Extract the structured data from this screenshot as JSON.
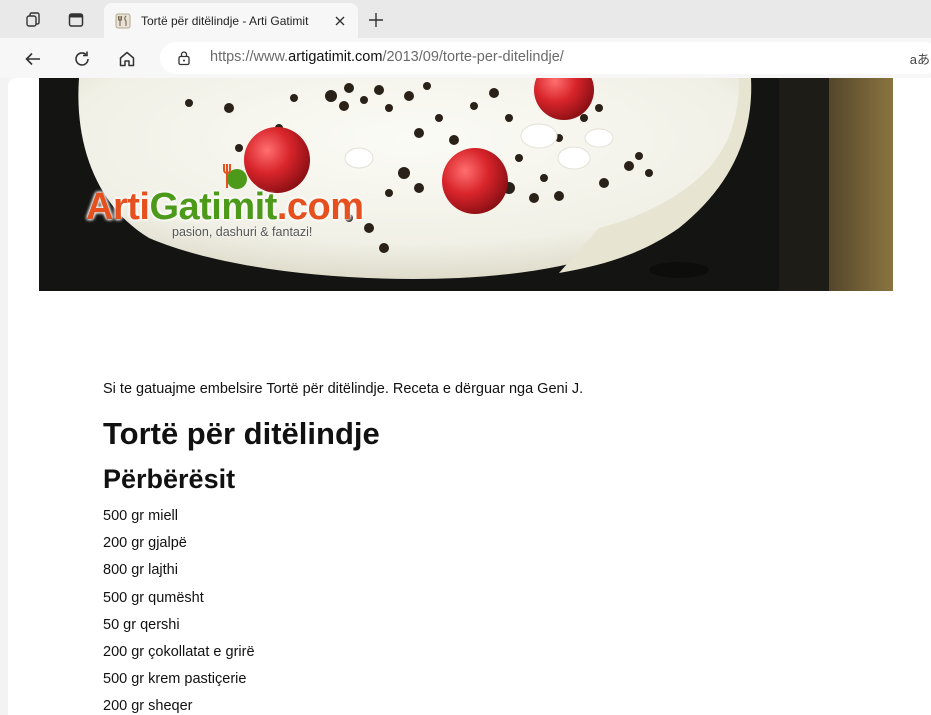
{
  "browser": {
    "tab": {
      "title": "Tortë për ditëlindje - Arti Gatimit",
      "close_glyph": "×"
    },
    "newtab_glyph": "+",
    "address": {
      "url_prefix": "https://www.",
      "url_host": "artigatimit.com",
      "url_path": "/2013/09/torte-per-ditelindje/",
      "read_aloud": "aあ"
    },
    "icons": {
      "workspaces": "workspaces-icon",
      "tab_actions": "tab-actions-icon",
      "back": "back-arrow-icon",
      "refresh": "refresh-icon",
      "home": "home-icon",
      "site_info": "lock-icon"
    }
  },
  "banner": {
    "logo_part1": "Arti",
    "logo_part2": "Gatimit",
    "logo_part3": ".com",
    "tagline": "pasion, dashuri & fantazi!"
  },
  "article": {
    "intro": "Si te gatuajme embelsire Tortë për ditëlindje. Receta e dërguar nga Geni J.",
    "title": "Tortë për ditëlindje",
    "ingredients_heading": "Përbërësit",
    "ingredients": [
      "500 gr miell",
      "200 gr gjalpë",
      "800 gr lajthi",
      "500 gr qumësht",
      "50 gr qershi",
      "200 gr çokollatat e grirë",
      "500 gr krem pastiçerie",
      "200 gr sheqer"
    ]
  },
  "colors": {
    "logo_orange": "#e5501e",
    "logo_green": "#4d9a1a",
    "cherry_red": "#d8252b"
  }
}
